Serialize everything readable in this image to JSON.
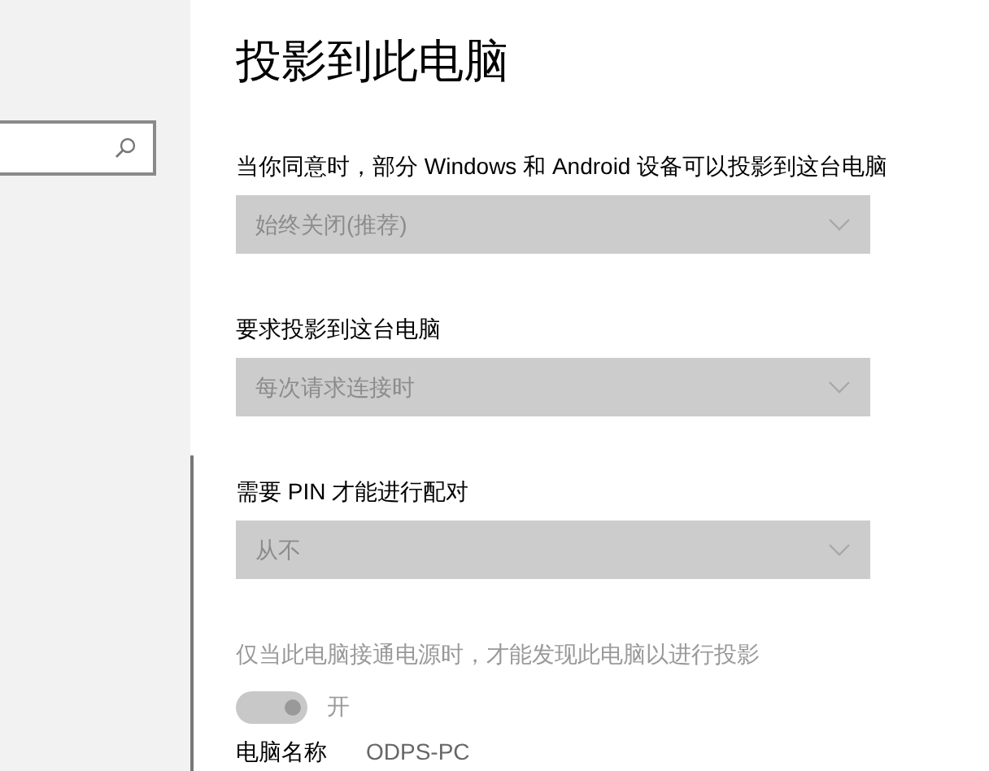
{
  "title": "投影到此电脑",
  "settings": [
    {
      "kind": "dropdown",
      "label": "当你同意时，部分 Windows 和 Android 设备可以投影到这台电脑",
      "value": "始终关闭(推荐)",
      "disabled": true
    },
    {
      "kind": "dropdown",
      "label": "要求投影到这台电脑",
      "value": "每次请求连接时",
      "disabled": true
    },
    {
      "kind": "dropdown",
      "label": "需要 PIN 才能进行配对",
      "value": "从不",
      "disabled": true
    },
    {
      "kind": "toggle",
      "label": "仅当此电脑接通电源时，才能发现此电脑以进行投影",
      "on": true,
      "state_text": "开",
      "disabled": true
    }
  ],
  "pc_name": {
    "label": "电脑名称",
    "value": "ODPS-PC"
  }
}
